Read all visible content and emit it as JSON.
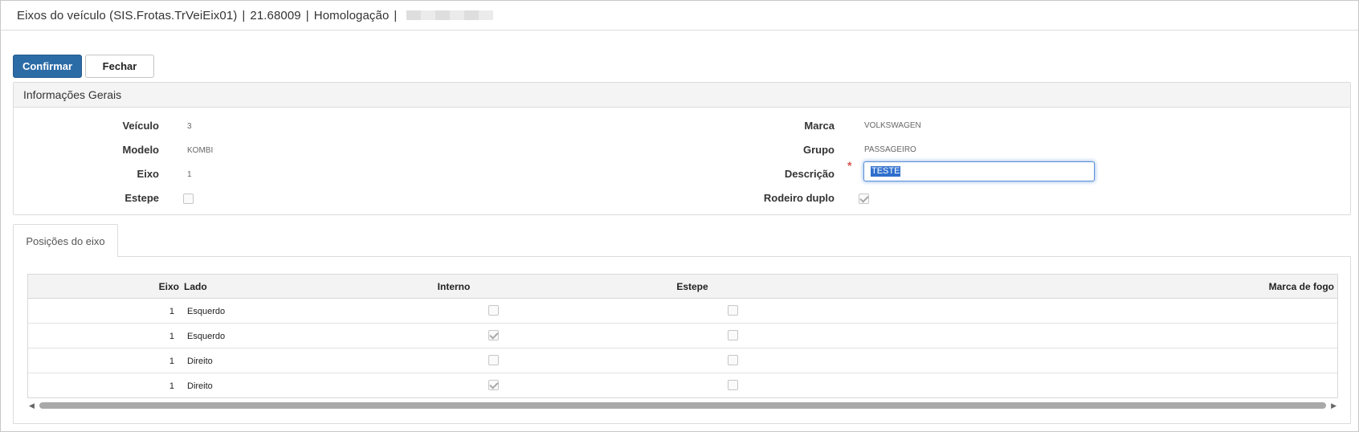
{
  "window": {
    "title": "Eixos do veículo (SIS.Frotas.TrVeiEix01)",
    "version": "21.68009",
    "environment": "Homologação"
  },
  "toolbar": {
    "confirm_label": "Confirmar",
    "close_label": "Fechar"
  },
  "general_panel": {
    "title": "Informações Gerais",
    "fields": {
      "veiculo_label": "Veículo",
      "veiculo_value": "3",
      "modelo_label": "Modelo",
      "modelo_value": "KOMBI",
      "eixo_label": "Eixo",
      "eixo_value": "1",
      "estepe_label": "Estepe",
      "marca_label": "Marca",
      "marca_value": "VOLKSWAGEN",
      "grupo_label": "Grupo",
      "grupo_value": "PASSAGEIRO",
      "descricao_label": "Descrição",
      "descricao_required": "*",
      "descricao_value": "TESTE",
      "rodeiro_label": "Rodeiro duplo"
    },
    "checkboxes": {
      "estepe": false,
      "rodeiro_duplo": true
    }
  },
  "tabs": [
    {
      "label": "Posições do eixo",
      "active": true
    }
  ],
  "grid": {
    "columns": {
      "eixo": "Eixo",
      "lado": "Lado",
      "interno": "Interno",
      "estepe": "Estepe",
      "marca_fogo": "Marca de fogo"
    },
    "rows": [
      {
        "eixo": "1",
        "lado": "Esquerdo",
        "interno": false,
        "estepe": false
      },
      {
        "eixo": "1",
        "lado": "Esquerdo",
        "interno": true,
        "estepe": false
      },
      {
        "eixo": "1",
        "lado": "Direito",
        "interno": false,
        "estepe": false
      },
      {
        "eixo": "1",
        "lado": "Direito",
        "interno": true,
        "estepe": false
      }
    ]
  },
  "icons": {
    "scroll_left": "scroll-left-arrow-icon",
    "scroll_right": "scroll-right-arrow-icon"
  },
  "colors": {
    "primary_button": "#2c6ca6",
    "required_marker": "#d9534f",
    "focus_border": "#5b8fd6"
  }
}
